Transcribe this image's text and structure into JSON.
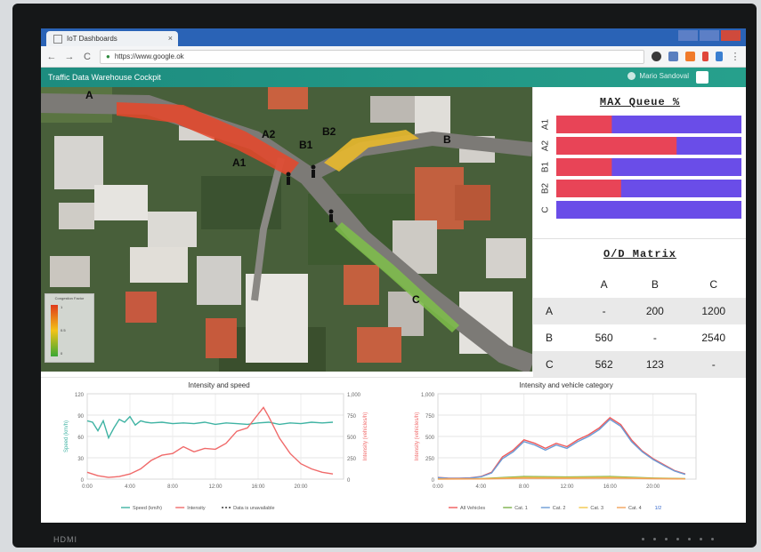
{
  "monitor": {
    "brand": "HDMI"
  },
  "browser": {
    "tab_title": "IoT Dashboards",
    "tab_close": "×",
    "url": "https://www.google.ok",
    "lock_icon": "lock-icon",
    "nav": {
      "back": "←",
      "forward": "→",
      "reload": "C"
    }
  },
  "app": {
    "title": "Traffic Data Warehouse Cockpit",
    "user_name": "Mario Sandoval"
  },
  "map": {
    "labels": [
      "A",
      "A2",
      "A1",
      "B1",
      "B2",
      "B",
      "C"
    ],
    "legend_title": "Congestion Factor",
    "legend_ticks": [
      "1",
      "0.5",
      "0"
    ],
    "colors": {
      "queue_red": "#e9462a",
      "queue_yellow": "#e9b92d",
      "road_green": "#7fbf4a"
    }
  },
  "max_queue": {
    "title": "MAX Queue %",
    "rows": [
      {
        "label": "A1",
        "value": 30
      },
      {
        "label": "A2",
        "value": 65
      },
      {
        "label": "B1",
        "value": 30
      },
      {
        "label": "B2",
        "value": 35
      },
      {
        "label": "C",
        "value": 0
      }
    ],
    "colors": {
      "queue": "#e84457",
      "remaining": "#6a4de8"
    }
  },
  "od_matrix": {
    "title": "O/D Matrix",
    "columns": [
      "A",
      "B",
      "C"
    ],
    "rows": [
      {
        "label": "A",
        "values": [
          "-",
          "200",
          "1200"
        ]
      },
      {
        "label": "B",
        "values": [
          "560",
          "-",
          "2540"
        ]
      },
      {
        "label": "C",
        "values": [
          "562",
          "123",
          "-"
        ]
      }
    ]
  },
  "chart_data": [
    {
      "type": "line",
      "title": "Intensity and speed",
      "ylabel": "Speed (km/h)",
      "y2label": "Intensity (vehicles/h)",
      "x_ticks": [
        "0:00",
        "4:00",
        "8:00",
        "12:00",
        "16:00",
        "20:00"
      ],
      "y_ticks": [
        "0",
        "30",
        "60",
        "90",
        "120"
      ],
      "y2_ticks": [
        "0",
        "250",
        "500",
        "750",
        "1,000"
      ],
      "ylim": [
        0,
        120
      ],
      "y2lim": [
        0,
        1000
      ],
      "legend": [
        "Speed (km/h)",
        "Intensity",
        "Data is unavailable"
      ],
      "series": [
        {
          "name": "Speed (km/h)",
          "axis": "left",
          "color": "#3fb3a3",
          "x": [
            0,
            0.5,
            1,
            1.5,
            2,
            2.5,
            3,
            3.5,
            4,
            4.5,
            5,
            5.5,
            6,
            7,
            8,
            9,
            10,
            11,
            12,
            13,
            14,
            15,
            16,
            17,
            18,
            19,
            20,
            21,
            22,
            23
          ],
          "values": [
            82,
            80,
            68,
            82,
            58,
            72,
            84,
            80,
            88,
            76,
            82,
            80,
            79,
            80,
            78,
            79,
            78,
            80,
            77,
            79,
            78,
            77,
            79,
            80,
            77,
            79,
            78,
            80,
            79,
            80
          ]
        },
        {
          "name": "Intensity",
          "axis": "right",
          "color": "#f06a6a",
          "x": [
            0,
            1,
            2,
            3,
            4,
            5,
            6,
            7,
            8,
            9,
            10,
            11,
            12,
            13,
            14,
            15,
            16,
            16.5,
            17,
            18,
            19,
            20,
            21,
            22,
            23
          ],
          "values": [
            80,
            40,
            20,
            30,
            60,
            120,
            220,
            280,
            300,
            380,
            320,
            360,
            350,
            420,
            560,
            600,
            760,
            840,
            730,
            480,
            300,
            180,
            120,
            80,
            60
          ]
        }
      ]
    },
    {
      "type": "line",
      "title": "Intensity and vehicle category",
      "ylabel": "Intensity (vehicles/h)",
      "x_ticks": [
        "0:00",
        "4:00",
        "8:00",
        "12:00",
        "16:00",
        "20:00"
      ],
      "y_ticks": [
        "0",
        "250",
        "500",
        "750",
        "1,000"
      ],
      "ylim": [
        0,
        1000
      ],
      "legend": [
        "All Vehicles",
        "Cat. 1",
        "Cat. 2",
        "Cat. 3",
        "Cat. 4"
      ],
      "legend_page": "1/2",
      "series": [
        {
          "name": "All Vehicles",
          "color": "#ef5a5a",
          "x": [
            0,
            1,
            2,
            3,
            4,
            5,
            6,
            7,
            8,
            9,
            10,
            11,
            12,
            13,
            14,
            15,
            16,
            17,
            18,
            19,
            20,
            21,
            22,
            23
          ],
          "values": [
            20,
            10,
            10,
            15,
            30,
            80,
            260,
            340,
            460,
            420,
            360,
            420,
            380,
            460,
            520,
            600,
            720,
            640,
            460,
            330,
            240,
            170,
            100,
            60
          ]
        },
        {
          "name": "Cat. 1",
          "color": "#7bb04a",
          "x": [
            0,
            4,
            8,
            12,
            16,
            20,
            23
          ],
          "values": [
            2,
            5,
            30,
            25,
            30,
            12,
            5
          ]
        },
        {
          "name": "Cat. 2",
          "color": "#6b9bd6",
          "x": [
            0,
            1,
            2,
            3,
            4,
            5,
            6,
            7,
            8,
            9,
            10,
            11,
            12,
            13,
            14,
            15,
            16,
            17,
            18,
            19,
            20,
            21,
            22,
            23
          ],
          "values": [
            18,
            8,
            8,
            12,
            26,
            72,
            240,
            320,
            440,
            400,
            340,
            400,
            360,
            440,
            500,
            580,
            700,
            620,
            440,
            320,
            230,
            160,
            95,
            55
          ]
        },
        {
          "name": "Cat. 3",
          "color": "#f2c84a",
          "x": [
            0,
            4,
            8,
            12,
            16,
            20,
            23
          ],
          "values": [
            1,
            3,
            20,
            18,
            22,
            8,
            3
          ]
        },
        {
          "name": "Cat. 4",
          "color": "#f2a15a",
          "x": [
            0,
            4,
            8,
            12,
            16,
            20,
            23
          ],
          "values": [
            1,
            2,
            10,
            8,
            12,
            5,
            2
          ]
        }
      ]
    }
  ]
}
